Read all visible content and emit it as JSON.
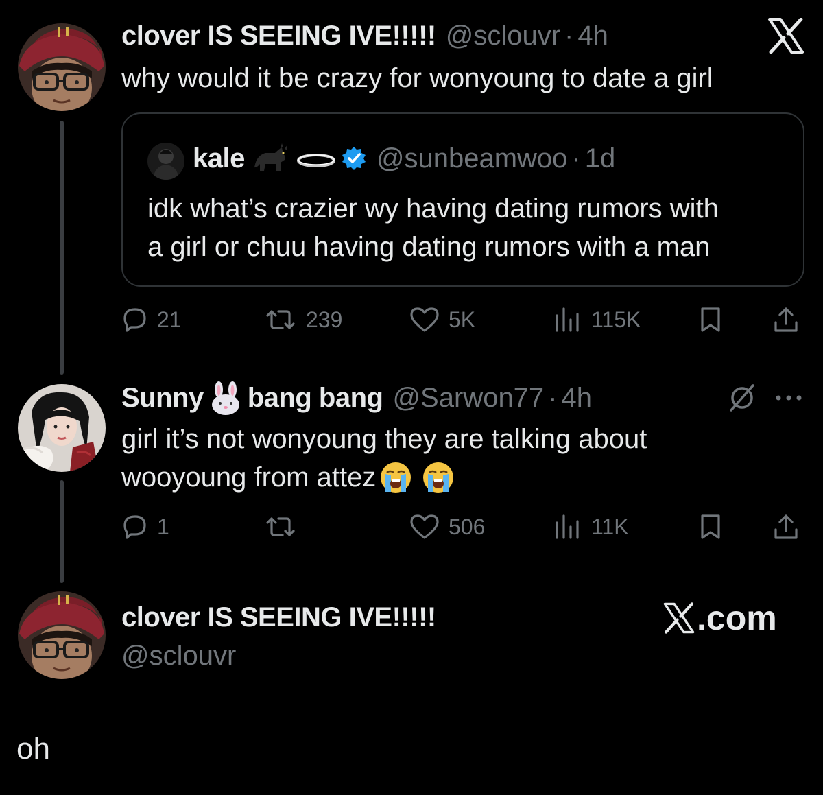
{
  "tweet1": {
    "display_name": "clover IS SEEING IVE!!!!!",
    "handle": "@sclouvr",
    "separator": "·",
    "time": "4h",
    "text": "why would it be crazy for wonyoung to date a girl",
    "brand_icon": "x-logo-icon",
    "quote": {
      "display_name": "kale",
      "name_emojis": [
        "black-cat-emoji",
        "halo-ring-emoji"
      ],
      "verified": true,
      "handle": "@sunbeamwoo",
      "separator": "·",
      "time": "1d",
      "text_line1": "idk what’s crazier wy having dating rumors with",
      "text_line2": "a girl or chuu having dating rumors with a man"
    },
    "actions": {
      "replies": "21",
      "reposts": "239",
      "likes": "5K",
      "views": "115K"
    }
  },
  "tweet2": {
    "display_name_part1": "Sunny",
    "name_emoji": "rabbit-face-emoji",
    "display_name_part2": "bang bang",
    "handle": "@Sarwon77",
    "separator": "·",
    "time": "4h",
    "text_line1": "girl it’s not wonyoung they are talking about",
    "text_line2": "wooyoung from attez",
    "trailing_emojis": [
      "loudly-crying-face-emoji",
      "loudly-crying-face-emoji"
    ],
    "actions": {
      "replies": "1",
      "reposts": "",
      "likes": "506",
      "views": "11K"
    }
  },
  "tweet3": {
    "display_name": "clover IS SEEING IVE!!!!!",
    "handle": "@sclouvr",
    "brand": "X.com"
  },
  "caption": "oh",
  "colors": {
    "background": "#000000",
    "text_primary": "#e7e9ea",
    "text_secondary": "#71767b",
    "border": "#2f3336",
    "verified_blue": "#1d9bf0"
  }
}
